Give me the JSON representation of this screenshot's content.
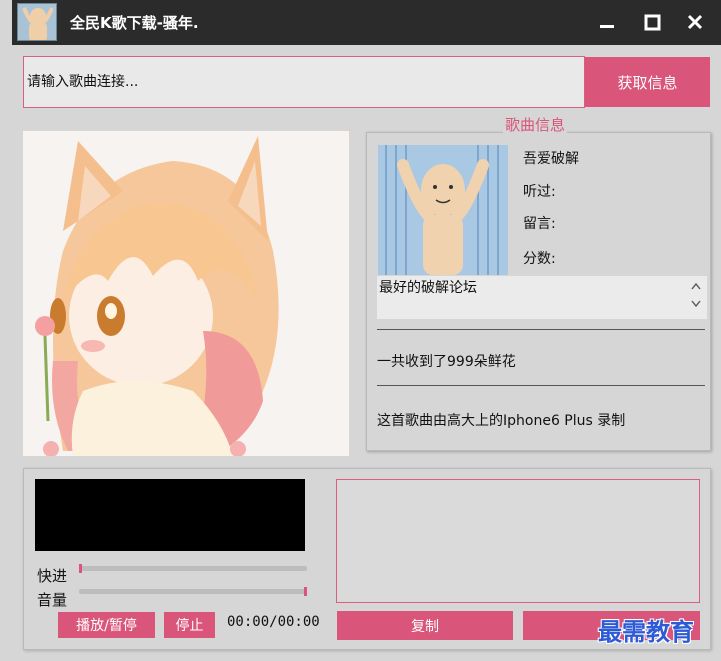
{
  "window": {
    "title": "全民K歌下载-骚年."
  },
  "url_row": {
    "placeholder": "请输入歌曲连接...",
    "fetch_label": "获取信息"
  },
  "song_info": {
    "group_title": "歌曲信息",
    "username": "吾爱破解",
    "listened_label": "听过:",
    "comments_label": "留言:",
    "score_label": "分数:",
    "comment_text": "最好的破解论坛",
    "flowers_text": "一共收到了999朵鲜花",
    "record_text": "这首歌曲由高大上的Iphone6 Plus 录制"
  },
  "player": {
    "fast_forward_label": "快进",
    "volume_label": "音量",
    "fast_forward_position": 0.0,
    "volume_level": 1.0,
    "play_pause_label": "播放/暂停",
    "stop_label": "停止",
    "time_text": "00:00/00:00",
    "copy_label": "复制"
  },
  "watermark": "最需教育",
  "colors": {
    "accent": "#d9557a",
    "titlebar": "#2b2b2b",
    "background": "#d6d6d6"
  },
  "icons": {
    "minimize": "minimize-icon",
    "maximize": "maximize-icon",
    "close": "close-icon",
    "scroll_up": "chevron-up-icon",
    "scroll_down": "chevron-down-icon"
  }
}
